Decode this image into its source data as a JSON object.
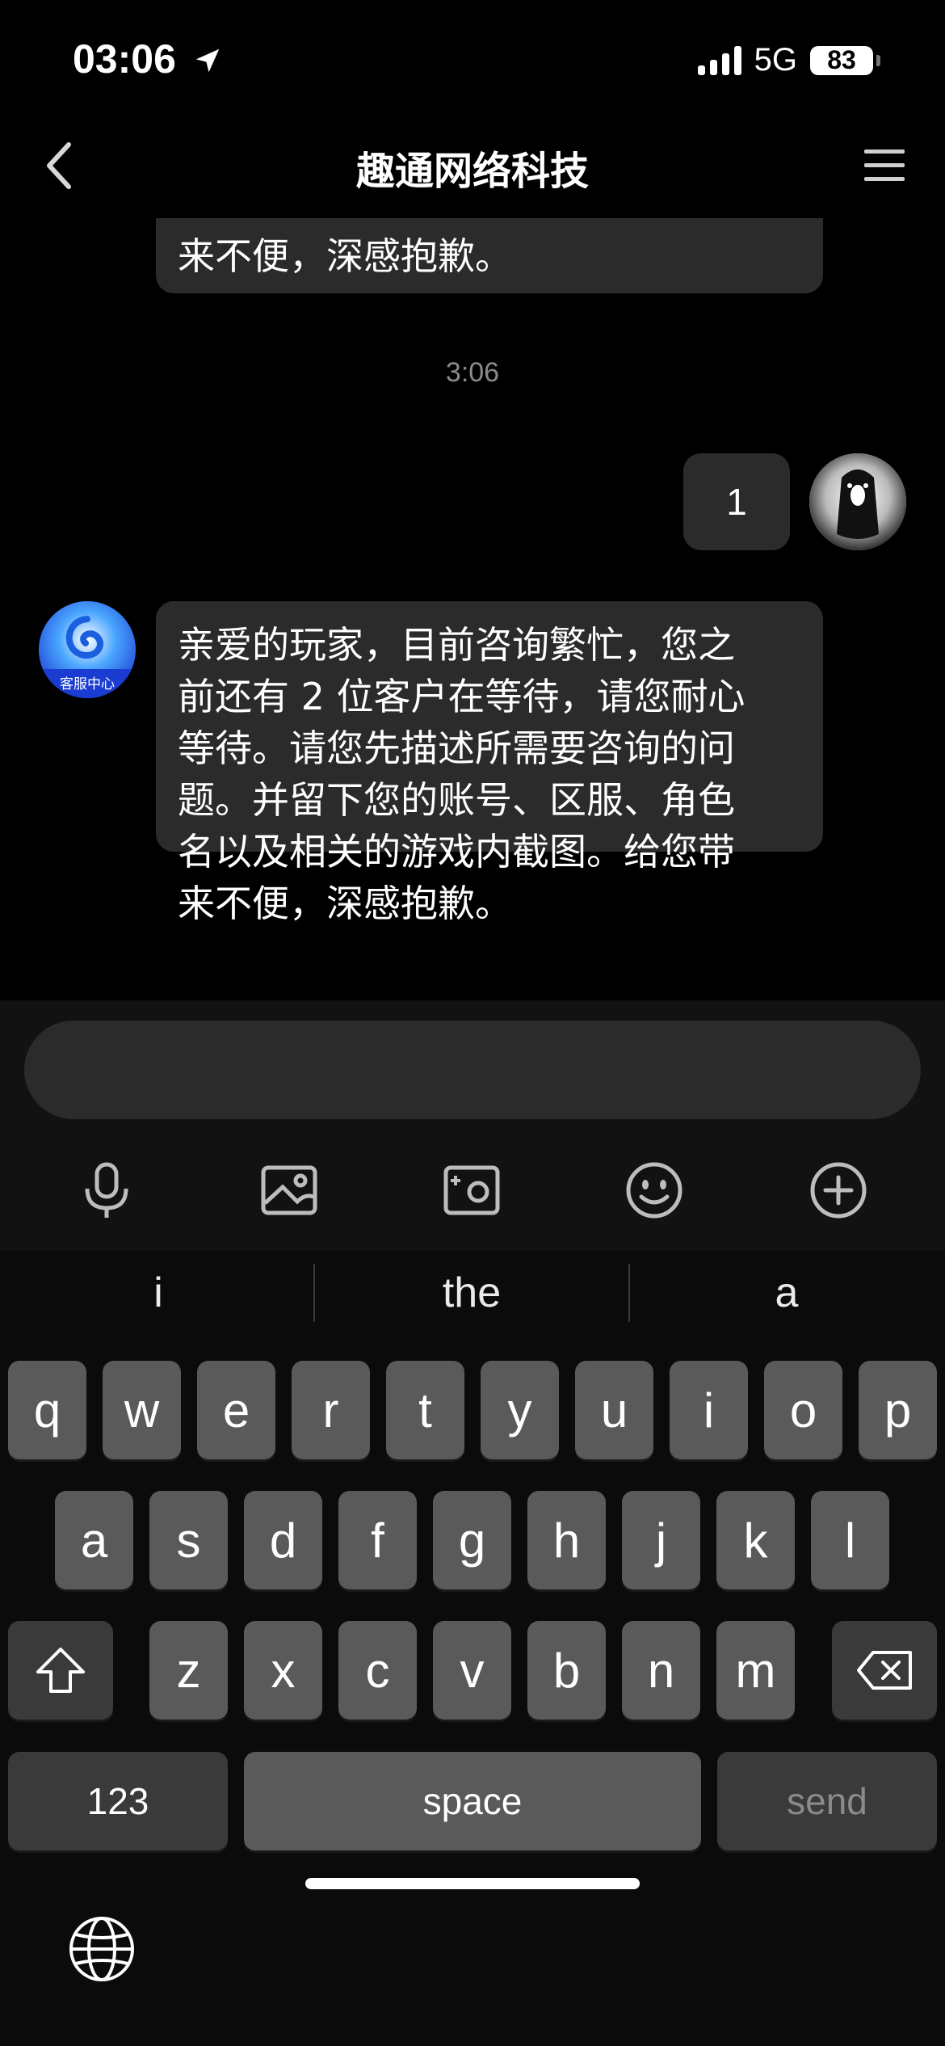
{
  "status": {
    "time": "03:06",
    "network": "5G",
    "battery": "83"
  },
  "nav": {
    "title": "趣通网络科技"
  },
  "chat": {
    "partial_message": "来不便，深感抱歉。",
    "timestamp": "3:06",
    "user_message": "1",
    "agent_message_lines": [
      "亲爱的玩家，目前咨询繁忙，您之",
      "前还有 2 位客户在等待，请您耐心",
      "等待。请您先描述所需要咨询的问",
      "题。并留下您的账号、区服、角色",
      "名以及相关的游戏内截图。给您带",
      "来不便，深感抱歉。"
    ],
    "agent_avatar_label": "客服中心"
  },
  "composer": {
    "input_value": ""
  },
  "keyboard": {
    "suggestions": [
      "i",
      "the",
      "a"
    ],
    "row1": [
      "q",
      "w",
      "e",
      "r",
      "t",
      "y",
      "u",
      "i",
      "o",
      "p"
    ],
    "row2": [
      "a",
      "s",
      "d",
      "f",
      "g",
      "h",
      "j",
      "k",
      "l"
    ],
    "row3": [
      "z",
      "x",
      "c",
      "v",
      "b",
      "n",
      "m"
    ],
    "numbers_label": "123",
    "space_label": "space",
    "send_label": "send"
  }
}
